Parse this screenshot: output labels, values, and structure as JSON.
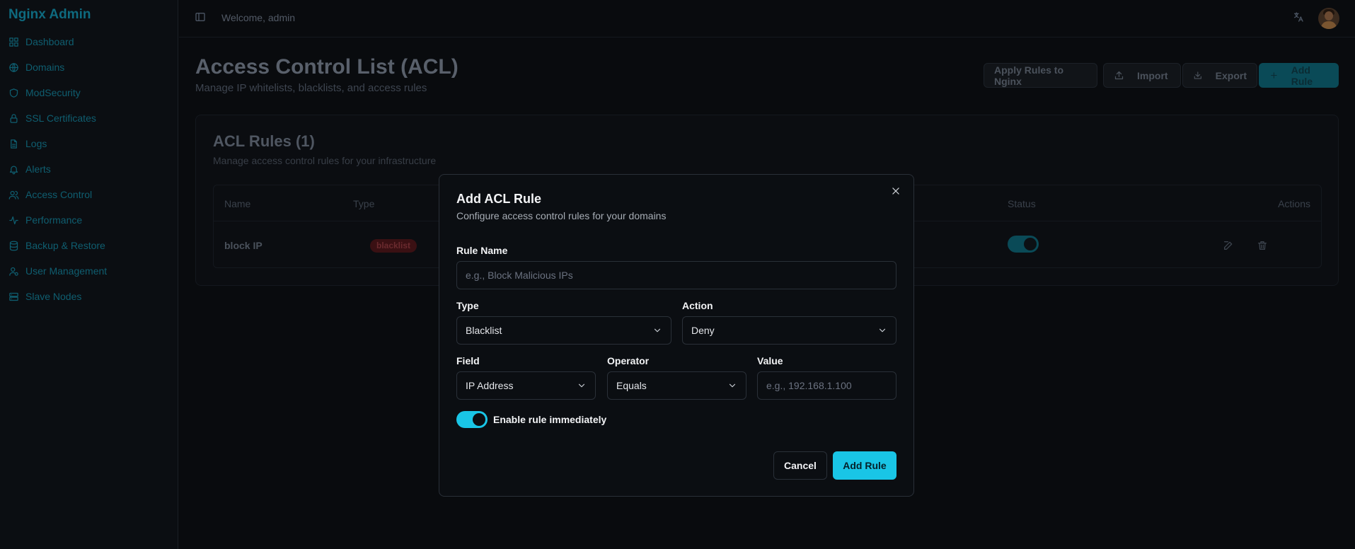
{
  "app": {
    "brand": "Nginx Admin"
  },
  "sidebar": {
    "items": [
      {
        "label": "Dashboard",
        "icon": "grid-icon"
      },
      {
        "label": "Domains",
        "icon": "globe-icon"
      },
      {
        "label": "ModSecurity",
        "icon": "shield-icon"
      },
      {
        "label": "SSL Certificates",
        "icon": "lock-icon"
      },
      {
        "label": "Logs",
        "icon": "file-text-icon"
      },
      {
        "label": "Alerts",
        "icon": "bell-icon"
      },
      {
        "label": "Access Control",
        "icon": "users-icon"
      },
      {
        "label": "Performance",
        "icon": "activity-icon"
      },
      {
        "label": "Backup & Restore",
        "icon": "database-icon"
      },
      {
        "label": "User Management",
        "icon": "user-cog-icon"
      },
      {
        "label": "Slave Nodes",
        "icon": "server-icon"
      }
    ]
  },
  "header": {
    "welcome": "Welcome, admin"
  },
  "page": {
    "title": "Access Control List (ACL)",
    "subtitle": "Manage IP whitelists, blacklists, and access rules",
    "buttons": {
      "apply": "Apply Rules to Nginx",
      "import": "Import",
      "export": "Export",
      "add": "Add Rule"
    }
  },
  "card": {
    "title": "ACL Rules (1)",
    "subtitle": "Manage access control rules for your infrastructure",
    "columns": {
      "name": "Name",
      "type": "Type",
      "status": "Status",
      "actions": "Actions"
    },
    "rows": [
      {
        "name": "block IP",
        "type": "blacklist",
        "enabled": true
      }
    ]
  },
  "modal": {
    "title": "Add ACL Rule",
    "subtitle": "Configure access control rules for your domains",
    "rule_name_label": "Rule Name",
    "rule_name_placeholder": "e.g., Block Malicious IPs",
    "type_label": "Type",
    "type_value": "Blacklist",
    "action_label": "Action",
    "action_value": "Deny",
    "field_label": "Field",
    "field_value": "IP Address",
    "operator_label": "Operator",
    "operator_value": "Equals",
    "value_label": "Value",
    "value_placeholder": "e.g., 192.168.1.100",
    "enable_label": "Enable rule immediately",
    "enabled": true,
    "cancel_label": "Cancel",
    "submit_label": "Add Rule"
  },
  "colors": {
    "accent": "#19c5e6",
    "badge_danger": "#3a1013"
  }
}
